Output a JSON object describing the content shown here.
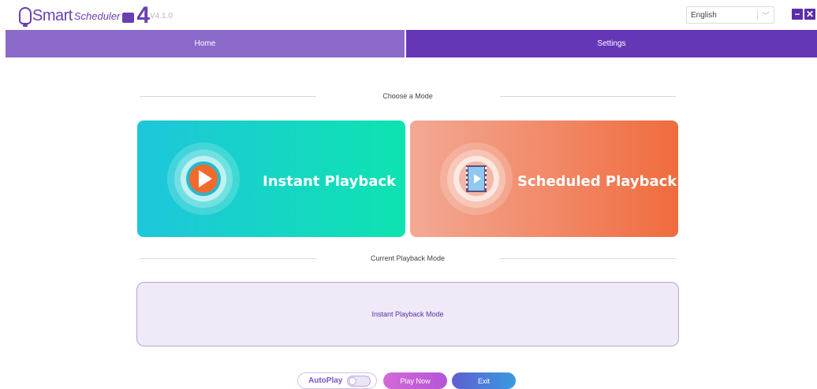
{
  "app": {
    "logo_word1": "Smart",
    "logo_word2": "Scheduler",
    "logo_number": "4",
    "version": "V4.1.0"
  },
  "language": {
    "selected": "English"
  },
  "window": {
    "minimize_icon": "minus-icon",
    "close_icon": "close-icon",
    "minimize_symbol": "−",
    "close_symbol": "✕"
  },
  "nav": {
    "home": "Home",
    "settings": "Settings"
  },
  "choose_mode": {
    "title": "Choose a Mode",
    "instant": {
      "label": "Instant Playback",
      "icon": "play-icon"
    },
    "scheduled": {
      "label": "Scheduled Playback",
      "icon": "film-icon"
    }
  },
  "current_mode": {
    "title": "Current Playback Mode",
    "value": "Instant Playback Mode"
  },
  "bottom": {
    "autoplay_label": "AutoPlay",
    "autoplay_state_text": "",
    "play_now": "Play Now",
    "exit": "Exit"
  },
  "colors": {
    "brand": "#6a3fb3",
    "home_tab": "#8c6ac9",
    "settings_tab": "#6537b6",
    "instant_start": "#1ec6dc",
    "instant_end": "#0ee3b0",
    "scheduled_start": "#f3a995",
    "scheduled_end": "#f06c3e"
  }
}
